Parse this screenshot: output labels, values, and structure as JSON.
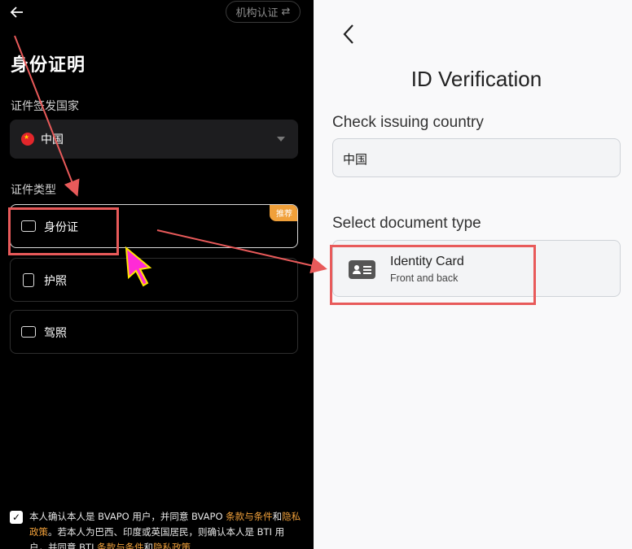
{
  "left": {
    "org_button": "机构认证",
    "title": "身份证明",
    "country_label": "证件签发国家",
    "country_value": "中国",
    "doctype_label": "证件类型",
    "docs": [
      {
        "label": "身份证",
        "badge": "推荐"
      },
      {
        "label": "护照"
      },
      {
        "label": "驾照"
      }
    ],
    "footer": {
      "p1": "本人确认本人是 BVAPO 用户，并同意 BVAPO ",
      "link1": "条款与条件",
      "and1": "和",
      "link2": "隐私政策",
      "p2": "。若本人为巴西、印度或英国居民，则确认本人是 BTI 用户，并同意 BTI ",
      "link3": "条款与条件",
      "and2": "和",
      "link4": "隐私政策"
    }
  },
  "right": {
    "title": "ID Verification",
    "country_label": "Check issuing country",
    "country_value": "中国",
    "doctype_label": "Select document type",
    "card": {
      "title": "Identity Card",
      "subtitle": "Front and back"
    }
  },
  "colors": {
    "highlight": "#e85a5a",
    "accent": "#f0a03a",
    "cursor": "#ff2bd6"
  }
}
